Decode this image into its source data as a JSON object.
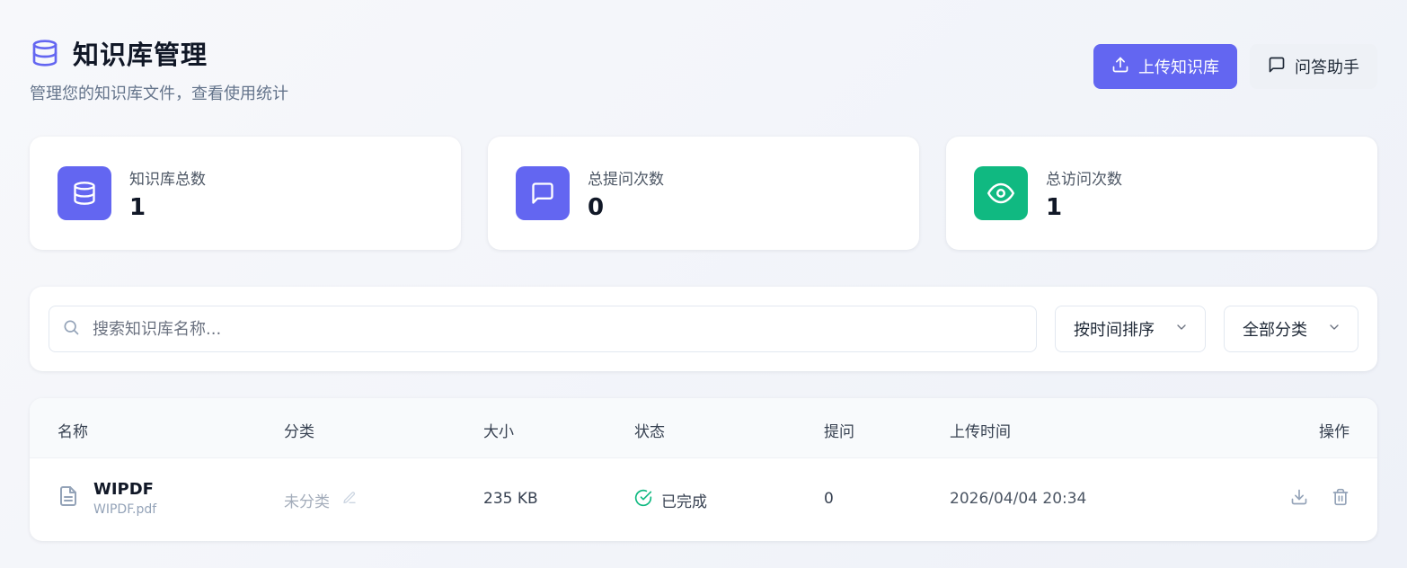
{
  "header": {
    "title": "知识库管理",
    "subtitle": "管理您的知识库文件，查看使用统计",
    "upload_label": "上传知识库",
    "assistant_label": "问答助手"
  },
  "stats": [
    {
      "label": "知识库总数",
      "value": "1",
      "icon": "database-icon",
      "color": "#6366f1"
    },
    {
      "label": "总提问次数",
      "value": "0",
      "icon": "message-icon",
      "color": "#6366f1"
    },
    {
      "label": "总访问次数",
      "value": "1",
      "icon": "eye-icon",
      "color": "#10b981"
    }
  ],
  "filters": {
    "search_placeholder": "搜索知识库名称...",
    "sort_label": "按时间排序",
    "category_label": "全部分类"
  },
  "table": {
    "headers": {
      "name": "名称",
      "category": "分类",
      "size": "大小",
      "status": "状态",
      "questions": "提问",
      "upload_time": "上传时间",
      "actions": "操作"
    },
    "rows": [
      {
        "name": "WIPDF",
        "filename": "WIPDF.pdf",
        "category": "未分类",
        "size": "235 KB",
        "status": "已完成",
        "questions": "0",
        "upload_time": "2026/04/04 20:34"
      }
    ]
  },
  "colors": {
    "accent": "#6366f1",
    "success": "#10b981"
  }
}
